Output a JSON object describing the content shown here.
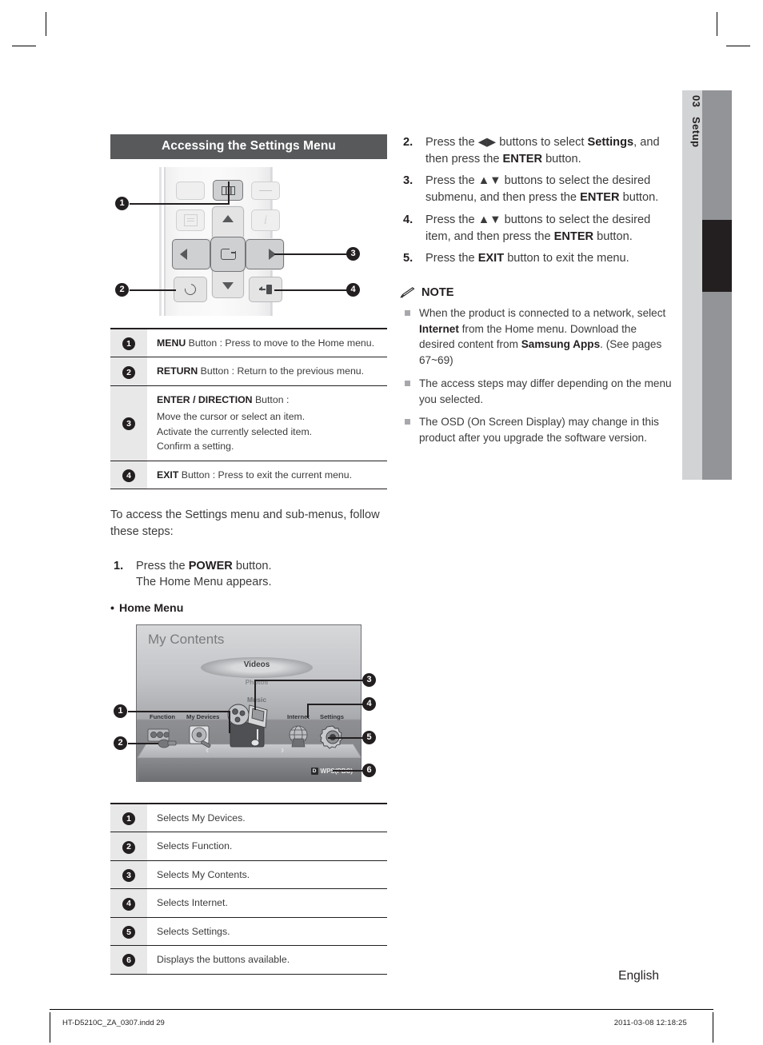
{
  "chapter_tab": {
    "number": "03",
    "label": "Setup"
  },
  "section": {
    "title": "Accessing the Settings Menu"
  },
  "remote_callouts": [
    {
      "n": "1"
    },
    {
      "n": "2"
    },
    {
      "n": "3"
    },
    {
      "n": "4"
    }
  ],
  "remote_table": [
    {
      "n": "1",
      "bold": "MENU",
      "text": " Button : Press to move to the Home menu.",
      "lines": []
    },
    {
      "n": "2",
      "bold": "RETURN",
      "text": " Button : Return to the previous menu.",
      "lines": []
    },
    {
      "n": "3",
      "bold": "ENTER / DIRECTION",
      "text": " Button :",
      "lines": [
        "Move the cursor or select an item.",
        "Activate the currently selected item.",
        "Confirm a setting."
      ]
    },
    {
      "n": "4",
      "bold": "EXIT",
      "text": " Button : Press to exit the current menu.",
      "lines": []
    }
  ],
  "intro": {
    "paragraph": "To access the Settings menu and sub-menus, follow these steps:"
  },
  "step1": {
    "num": "1.",
    "pre": "Press the ",
    "bold": "POWER",
    "post": " button.",
    "line2": "The Home Menu appears."
  },
  "home_menu_heading": {
    "bullet": "•",
    "label": "Home Menu"
  },
  "home_menu_screen": {
    "title": "My Contents",
    "carousel": {
      "selected": "Videos",
      "second": "Photos",
      "third": "Music"
    },
    "shelf_labels": [
      "Function",
      "My Devices",
      "Internet",
      "Settings"
    ],
    "wps_badge": "D",
    "wps_label": "WPS(PBC)",
    "left_arrow": "‹",
    "right_arrow": "›",
    "callouts": [
      "1",
      "2",
      "3",
      "4",
      "5",
      "6"
    ]
  },
  "home_table": [
    {
      "n": "1",
      "text": "Selects My Devices."
    },
    {
      "n": "2",
      "text": "Selects Function."
    },
    {
      "n": "3",
      "text": "Selects My Contents."
    },
    {
      "n": "4",
      "text": "Selects Internet."
    },
    {
      "n": "5",
      "text": "Selects Settings."
    },
    {
      "n": "6",
      "text": "Displays the buttons available."
    }
  ],
  "steps": [
    {
      "num": "2.",
      "parts": [
        {
          "t": "Press the "
        },
        {
          "t": "◀▶",
          "style": "arrows"
        },
        {
          "t": " buttons to select "
        },
        {
          "t": "Settings",
          "style": "bold"
        },
        {
          "t": ", and then press the "
        },
        {
          "t": "ENTER",
          "style": "bold"
        },
        {
          "t": " button."
        }
      ]
    },
    {
      "num": "3.",
      "parts": [
        {
          "t": "Press the "
        },
        {
          "t": "▲▼",
          "style": "arrows"
        },
        {
          "t": " buttons to select the desired submenu, and then press the "
        },
        {
          "t": "ENTER",
          "style": "bold"
        },
        {
          "t": " button."
        }
      ]
    },
    {
      "num": "4.",
      "parts": [
        {
          "t": "Press the "
        },
        {
          "t": "▲▼",
          "style": "arrows"
        },
        {
          "t": " buttons to select the desired item, and then press the "
        },
        {
          "t": "ENTER",
          "style": "bold"
        },
        {
          "t": " button."
        }
      ]
    },
    {
      "num": "5.",
      "parts": [
        {
          "t": "Press the "
        },
        {
          "t": "EXIT",
          "style": "bold"
        },
        {
          "t": " button to exit the menu."
        }
      ]
    }
  ],
  "note": {
    "icon": "pencil-icon",
    "heading": "NOTE",
    "items": [
      {
        "parts": [
          {
            "t": "When the product is connected to a network, select "
          },
          {
            "t": "Internet",
            "style": "bold"
          },
          {
            "t": " from the Home menu. Download the desired content from "
          },
          {
            "t": "Samsung Apps",
            "style": "bold"
          },
          {
            "t": ". (See pages 67~69)"
          }
        ]
      },
      {
        "parts": [
          {
            "t": "The access steps may differ depending on the menu you selected."
          }
        ]
      },
      {
        "parts": [
          {
            "t": "The OSD (On Screen Display) may change in this product after you upgrade the software version."
          }
        ]
      }
    ]
  },
  "footer": {
    "language": "English",
    "filename": "HT-D5210C_ZA_0307.indd   29",
    "timestamp": "2011-03-08    12:18:25"
  },
  "colors": {
    "section_bar": "#58595b",
    "ink": "#231f20",
    "tab_gray": "#929497",
    "tab_light": "#d2d3d5",
    "table_numcell": "#e8e8e9"
  }
}
